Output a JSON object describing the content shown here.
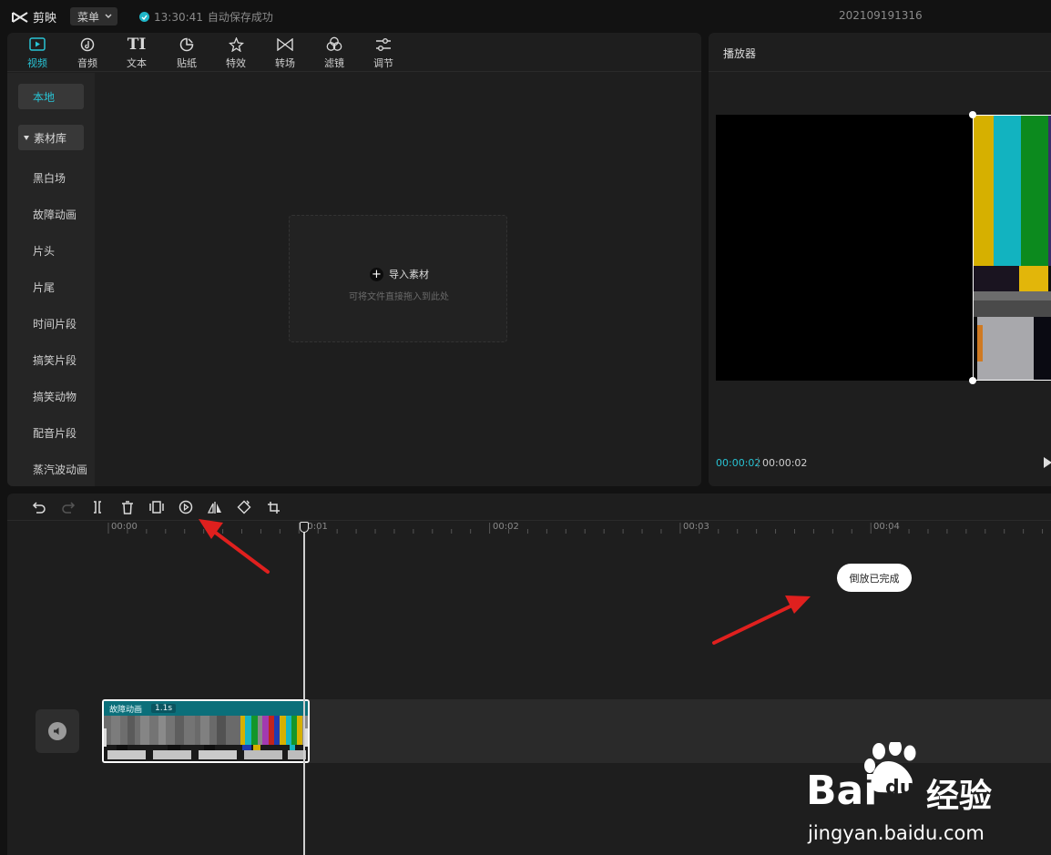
{
  "app": {
    "name": "剪映",
    "menu_label": "菜单",
    "save_time": "13:30:41",
    "save_status": "自动保存成功",
    "project_name": "202109191316"
  },
  "media": {
    "tabs": [
      {
        "label": "视频",
        "icon": "video-icon",
        "active": true
      },
      {
        "label": "音频",
        "icon": "audio-icon",
        "active": false
      },
      {
        "label": "文本",
        "icon": "text-icon",
        "active": false
      },
      {
        "label": "贴纸",
        "icon": "sticker-icon",
        "active": false
      },
      {
        "label": "特效",
        "icon": "effects-icon",
        "active": false
      },
      {
        "label": "转场",
        "icon": "transition-icon",
        "active": false
      },
      {
        "label": "滤镜",
        "icon": "filter-icon",
        "active": false
      },
      {
        "label": "调节",
        "icon": "adjust-icon",
        "active": false
      }
    ],
    "local_label": "本地",
    "library_label": "素材库",
    "library_items": [
      "黑白场",
      "故障动画",
      "片头",
      "片尾",
      "时间片段",
      "搞笑片段",
      "搞笑动物",
      "配音片段",
      "蒸汽波动画"
    ],
    "import_label": "导入素材",
    "import_hint": "可将文件直接拖入到此处"
  },
  "player": {
    "title": "播放器",
    "current_time": "00:00:02",
    "total_time": "00:00:02"
  },
  "timeline": {
    "tools": [
      "undo-icon",
      "redo-icon",
      "split-icon",
      "delete-icon",
      "freeze-icon",
      "reverse-icon",
      "mirror-icon",
      "rotate-icon",
      "crop-icon"
    ],
    "ruler_labels": [
      "00:00",
      "00:01",
      "00:02",
      "00:03",
      "00:04"
    ],
    "toast": "倒放已完成",
    "clip": {
      "name": "故障动画",
      "duration": "1.1s"
    }
  },
  "watermark": {
    "brand": "Bai",
    "brand_suffix": "du",
    "cn": "经验",
    "url": "jingyan.baidu.com"
  },
  "colors": {
    "accent": "#28c3d4",
    "clip_header": "#0b6f7a",
    "annotation_arrow": "#e0201e"
  }
}
